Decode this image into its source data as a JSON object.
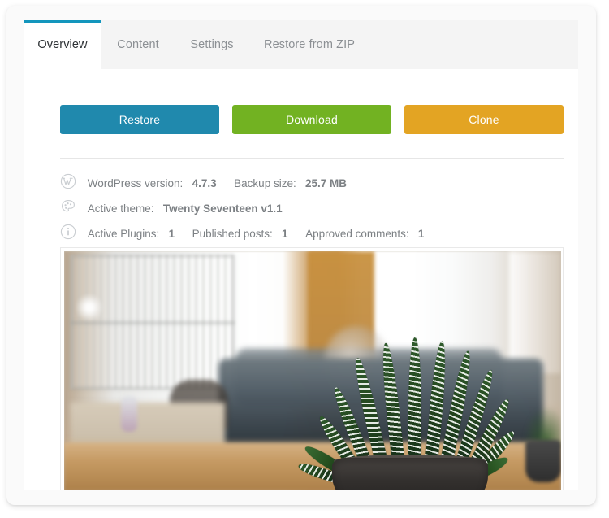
{
  "tabs": [
    {
      "label": "Overview",
      "active": true
    },
    {
      "label": "Content",
      "active": false
    },
    {
      "label": "Settings",
      "active": false
    },
    {
      "label": "Restore from ZIP",
      "active": false
    }
  ],
  "actions": {
    "restore_label": "Restore",
    "download_label": "Download",
    "clone_label": "Clone",
    "restore_color": "#2089ad",
    "download_color": "#72b222",
    "clone_color": "#e3a423"
  },
  "accent_color": "#1396bd",
  "info": {
    "row1": {
      "icon": "wordpress-icon",
      "wp_version_label": "WordPress version:",
      "wp_version_value": "4.7.3",
      "backup_size_label": "Backup size:",
      "backup_size_value": "25.7 MB"
    },
    "row2": {
      "icon": "palette-icon",
      "active_theme_label": "Active theme:",
      "active_theme_value": "Twenty Seventeen v1.1"
    },
    "row3": {
      "icon": "info-circle-icon",
      "active_plugins_label": "Active Plugins:",
      "active_plugins_value": "1",
      "published_posts_label": "Published posts:",
      "published_posts_value": "1",
      "approved_comments_label": "Approved comments:",
      "approved_comments_value": "1"
    }
  },
  "preview": {
    "name": "site-screenshot-preview",
    "description": "Blurred living room interior with a zebra haworthia succulent in a dark pot on a wooden table"
  }
}
